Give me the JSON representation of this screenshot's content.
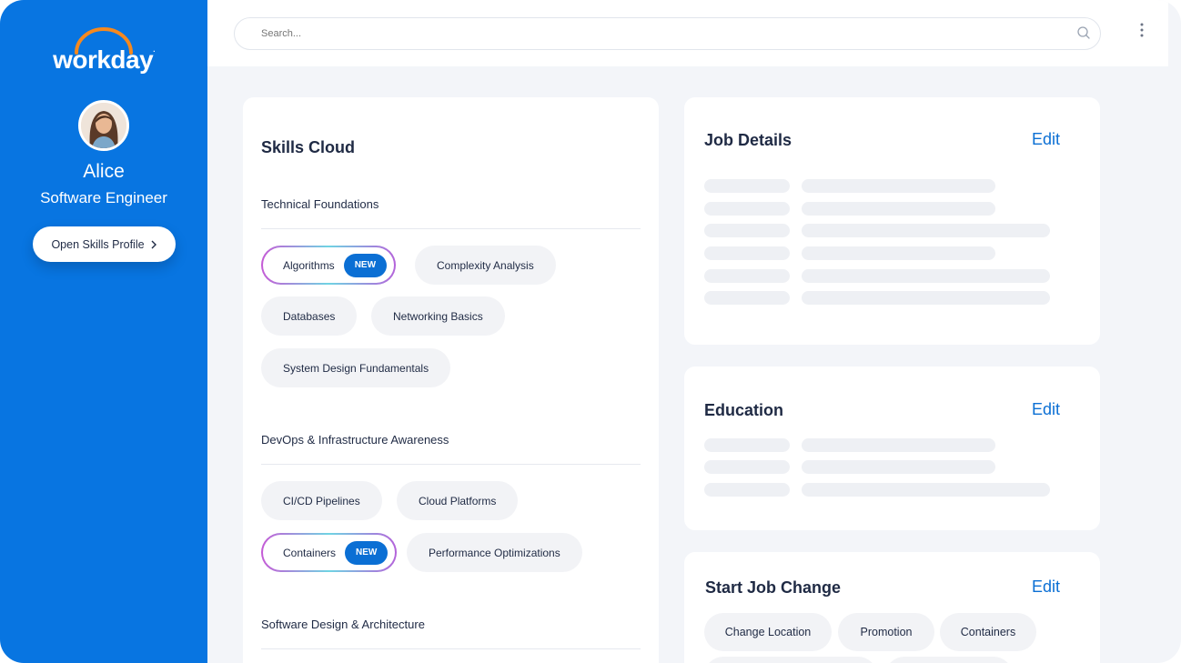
{
  "brand": {
    "name": "workday",
    "trademark": "."
  },
  "sidebar": {
    "user_name": "Alice",
    "user_title": "Software Engineer",
    "profile_button": "Open Skills Profile",
    "accent_color": "#0875e1"
  },
  "search": {
    "placeholder": "Search..."
  },
  "skills_cloud": {
    "title": "Skills Cloud",
    "sections": [
      {
        "title": "Technical Foundations",
        "skills": [
          {
            "label": "Algorithms",
            "badge": "NEW"
          },
          {
            "label": "Complexity Analysis"
          },
          {
            "label": "Databases"
          },
          {
            "label": "Networking Basics"
          },
          {
            "label": "System Design Fundamentals"
          }
        ]
      },
      {
        "title": "DevOps & Infrastructure Awareness",
        "skills": [
          {
            "label": "CI/CD Pipelines"
          },
          {
            "label": "Cloud Platforms"
          },
          {
            "label": "Containers",
            "badge": "NEW"
          },
          {
            "label": "Performance Optimizations"
          }
        ]
      },
      {
        "title": "Software Design & Architecture",
        "skills": []
      }
    ]
  },
  "job_details": {
    "title": "Job Details",
    "edit_label": "Edit"
  },
  "education": {
    "title": "Education",
    "edit_label": "Edit"
  },
  "job_change": {
    "title": "Start Job Change",
    "edit_label": "Edit",
    "options": [
      "Change Location",
      "Promotion",
      "Containers"
    ]
  }
}
